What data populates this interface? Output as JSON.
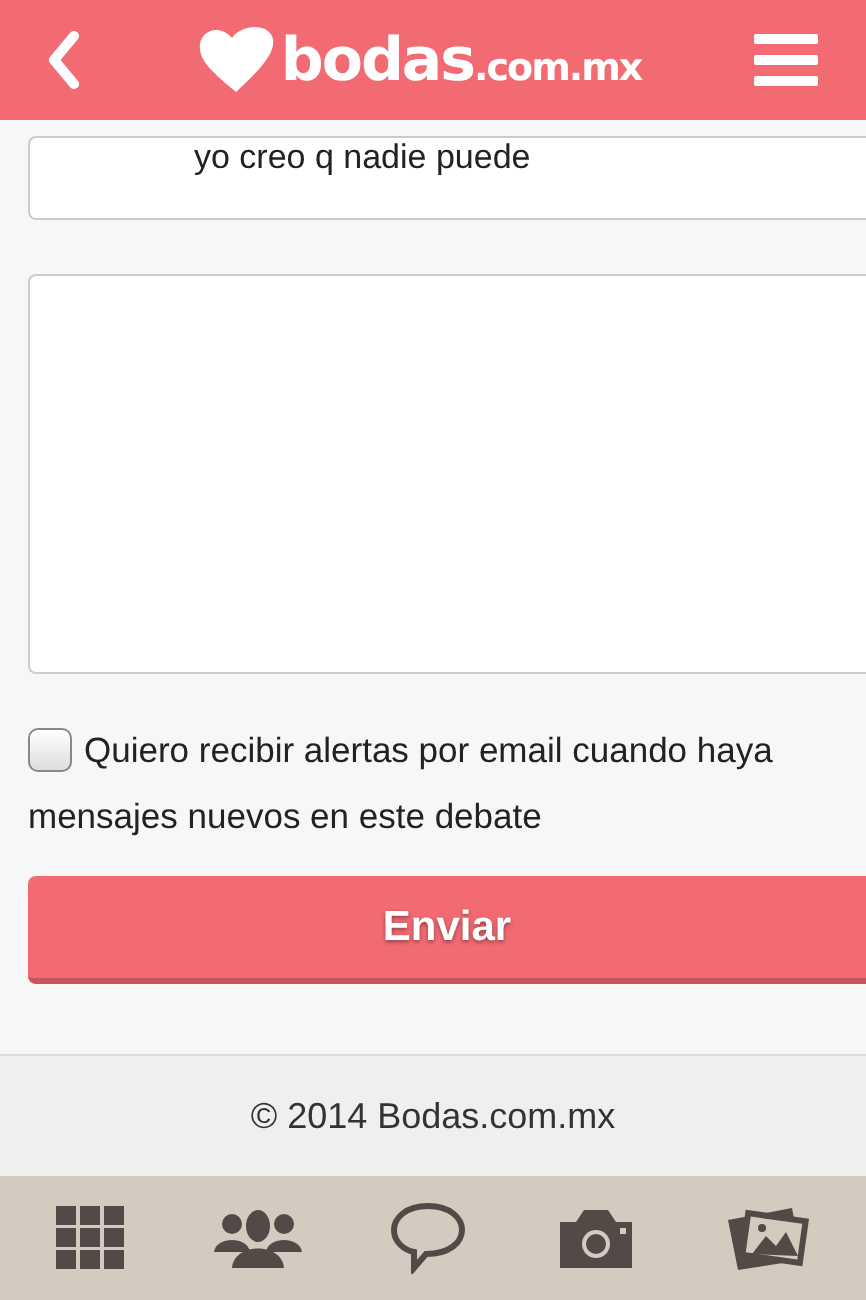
{
  "header": {
    "logo_text": "bodas",
    "logo_suffix": ".com.mx"
  },
  "previous_message": {
    "value": "yo creo q nadie puede"
  },
  "alerts_option": {
    "label": "Quiero recibir alertas por email cuando haya mensajes nuevos en este debate",
    "checked": false
  },
  "submit_button": {
    "label": "Enviar"
  },
  "footer": {
    "text": "© 2014 Bodas.com.mx"
  },
  "tab_bar": [
    {
      "kind": "grid"
    },
    {
      "kind": "people"
    },
    {
      "kind": "chat"
    },
    {
      "kind": "camera"
    },
    {
      "kind": "photos"
    }
  ]
}
